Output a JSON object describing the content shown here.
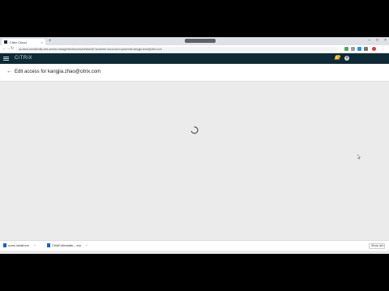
{
  "browser": {
    "tab_title": "Citrix Cloud",
    "tab_close": "×",
    "new_tab": "+",
    "window_controls": [
      "–",
      "□",
      "×"
    ],
    "url": "us.cloud.com/identity-and-access-management/access/edit/admin?customer=cloud-acct-xyz&email=kangjia.zhao@citrix.com"
  },
  "appbar": {
    "logo": "CiTRiX",
    "help": "?"
  },
  "page": {
    "back": "←",
    "title": "Edit access for kangjia.zhao@citrix.com"
  },
  "downloads": {
    "items": [
      {
        "label": "some-install.exe",
        "caret": "^"
      },
      {
        "label": "CWAFullInstaller....exe",
        "caret": "^"
      }
    ],
    "show_all": "Show all",
    "close": "×"
  }
}
